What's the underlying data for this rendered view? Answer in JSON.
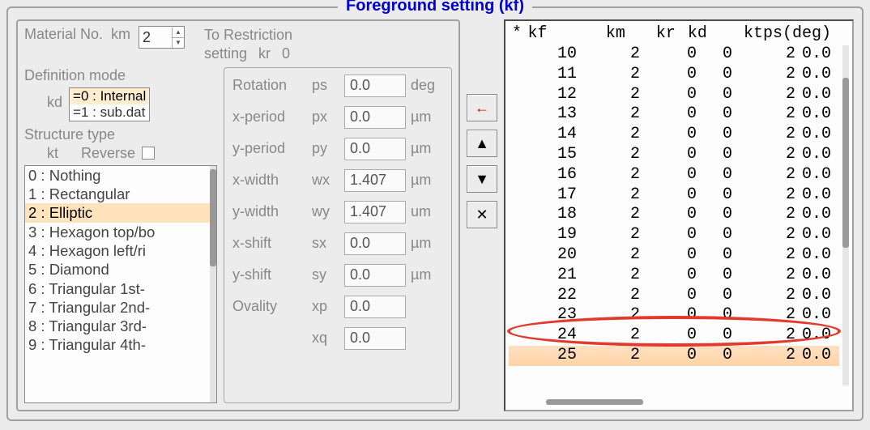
{
  "fieldset_title": "Foreground setting (kf)",
  "material": {
    "label": "Material No.",
    "sym": "km",
    "value": "2"
  },
  "to_restriction": {
    "line1": "To Restriction",
    "line2": "setting",
    "sym": "kr",
    "value": "0"
  },
  "def_mode": {
    "label": "Definition mode",
    "sym": "kd",
    "options": [
      "=0 : Internal",
      "=1 : sub.dat"
    ],
    "selected_index": 0
  },
  "struct": {
    "label": "Structure type",
    "sym": "kt",
    "reverse_label": "Reverse",
    "reverse_checked": false,
    "options": [
      "0 : Nothing",
      "1 : Rectangular",
      "2 : Elliptic",
      "3 : Hexagon top/bo",
      "4 : Hexagon left/ri",
      "5 : Diamond",
      "6 : Triangular 1st-",
      "7 : Triangular 2nd-",
      "8 : Triangular 3rd-",
      "9 : Triangular 4th-"
    ],
    "selected_index": 2
  },
  "params": [
    {
      "name": "Rotation",
      "sym": "ps",
      "value": "0.0",
      "unit": "deg"
    },
    {
      "name": "x-period",
      "sym": "px",
      "value": "0.0",
      "unit": "µm"
    },
    {
      "name": "y-period",
      "sym": "py",
      "value": "0.0",
      "unit": "µm"
    },
    {
      "name": "x-width",
      "sym": "wx",
      "value": "1.407",
      "unit": "µm"
    },
    {
      "name": "y-width",
      "sym": "wy",
      "value": "1.407",
      "unit": "um"
    },
    {
      "name": "x-shift",
      "sym": "sx",
      "value": "0.0",
      "unit": "µm"
    },
    {
      "name": "y-shift",
      "sym": "sy",
      "value": "0.0",
      "unit": "µm"
    },
    {
      "name": "Ovality",
      "sym": "xp",
      "value": "0.0",
      "unit": ""
    },
    {
      "name": "",
      "sym": "xq",
      "value": "0.0",
      "unit": ""
    }
  ],
  "buttons": {
    "back": "←",
    "up": "▲",
    "down": "▼",
    "delete": "✕"
  },
  "table": {
    "star": "*",
    "headers": {
      "kf": "kf",
      "km": "km",
      "kr": "kr",
      "kd": "kd",
      "kt": "kt",
      "ps": "ps(deg)"
    },
    "rows": [
      {
        "kf": "10",
        "km": "2",
        "kr": "0",
        "kd": "0",
        "kt": "2",
        "ps": "0.0"
      },
      {
        "kf": "11",
        "km": "2",
        "kr": "0",
        "kd": "0",
        "kt": "2",
        "ps": "0.0"
      },
      {
        "kf": "12",
        "km": "2",
        "kr": "0",
        "kd": "0",
        "kt": "2",
        "ps": "0.0"
      },
      {
        "kf": "13",
        "km": "2",
        "kr": "0",
        "kd": "0",
        "kt": "2",
        "ps": "0.0"
      },
      {
        "kf": "14",
        "km": "2",
        "kr": "0",
        "kd": "0",
        "kt": "2",
        "ps": "0.0"
      },
      {
        "kf": "15",
        "km": "2",
        "kr": "0",
        "kd": "0",
        "kt": "2",
        "ps": "0.0"
      },
      {
        "kf": "16",
        "km": "2",
        "kr": "0",
        "kd": "0",
        "kt": "2",
        "ps": "0.0"
      },
      {
        "kf": "17",
        "km": "2",
        "kr": "0",
        "kd": "0",
        "kt": "2",
        "ps": "0.0"
      },
      {
        "kf": "18",
        "km": "2",
        "kr": "0",
        "kd": "0",
        "kt": "2",
        "ps": "0.0"
      },
      {
        "kf": "19",
        "km": "2",
        "kr": "0",
        "kd": "0",
        "kt": "2",
        "ps": "0.0"
      },
      {
        "kf": "20",
        "km": "2",
        "kr": "0",
        "kd": "0",
        "kt": "2",
        "ps": "0.0"
      },
      {
        "kf": "21",
        "km": "2",
        "kr": "0",
        "kd": "0",
        "kt": "2",
        "ps": "0.0"
      },
      {
        "kf": "22",
        "km": "2",
        "kr": "0",
        "kd": "0",
        "kt": "2",
        "ps": "0.0"
      },
      {
        "kf": "23",
        "km": "2",
        "kr": "0",
        "kd": "0",
        "kt": "2",
        "ps": "0.0"
      },
      {
        "kf": "24",
        "km": "2",
        "kr": "0",
        "kd": "0",
        "kt": "2",
        "ps": "0.0"
      },
      {
        "kf": "25",
        "km": "2",
        "kr": "0",
        "kd": "0",
        "kt": "2",
        "ps": "0.0"
      }
    ],
    "highlighted_row_index": 15
  }
}
